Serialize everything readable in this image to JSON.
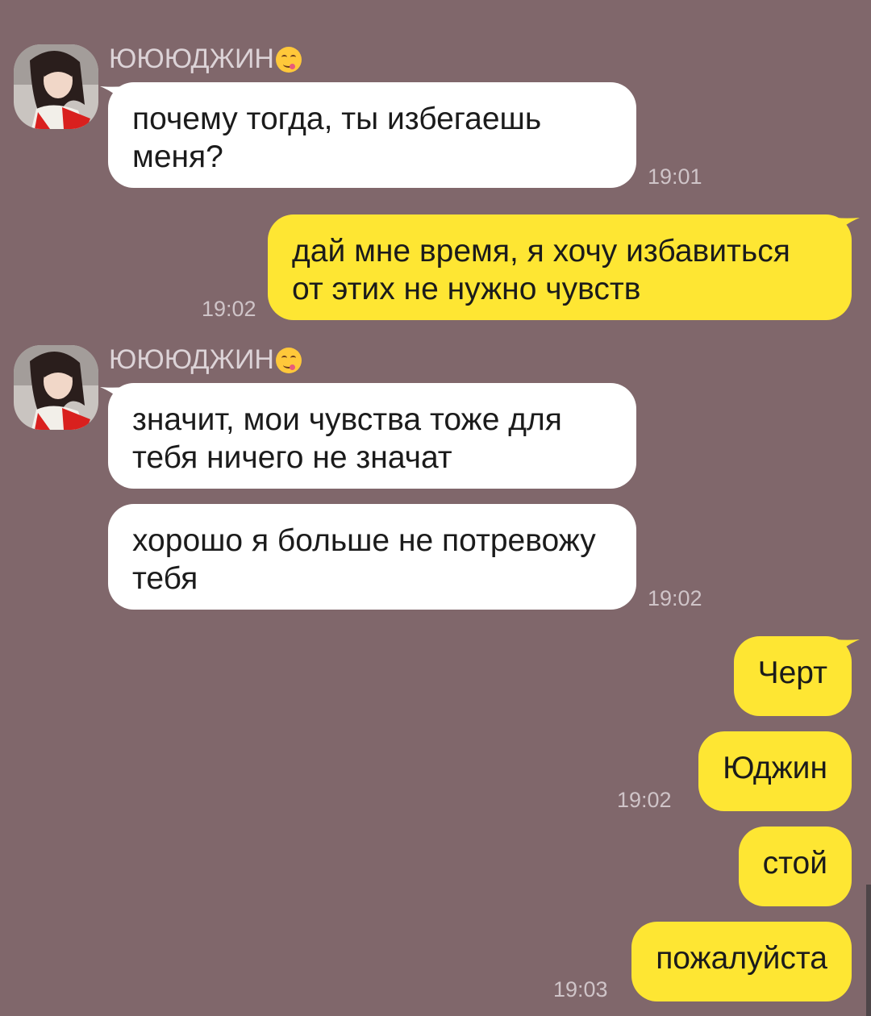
{
  "colors": {
    "background": "#80676b",
    "incoming_bubble": "#ffffff",
    "outgoing_bubble": "#fee633",
    "text": "#1b1b1b",
    "meta_text": "#dcd3d7"
  },
  "chat": {
    "groups": [
      {
        "sender": "ЮЮЮДЖИН",
        "sender_emoji": "yum-face-icon",
        "messages": [
          {
            "text": "почему тогда, ты избегаешь меня?",
            "time": "19:01"
          }
        ]
      },
      {
        "outgoing": true,
        "messages": [
          {
            "text": "дай мне время, я хочу избавиться от этих не нужно чувств",
            "time": "19:02"
          }
        ]
      },
      {
        "sender": "ЮЮЮДЖИН",
        "sender_emoji": "yum-face-icon",
        "messages": [
          {
            "text": "значит, мои чувства тоже для тебя ничего не значат"
          },
          {
            "text": "хорошо я больше не потревожу тебя",
            "time": "19:02"
          }
        ]
      },
      {
        "outgoing": true,
        "messages": [
          {
            "text": "Черт"
          },
          {
            "text": "Юджин",
            "time": "19:02"
          },
          {
            "text": "стой"
          },
          {
            "text": "пожалуйста",
            "time": "19:03"
          }
        ]
      }
    ]
  }
}
